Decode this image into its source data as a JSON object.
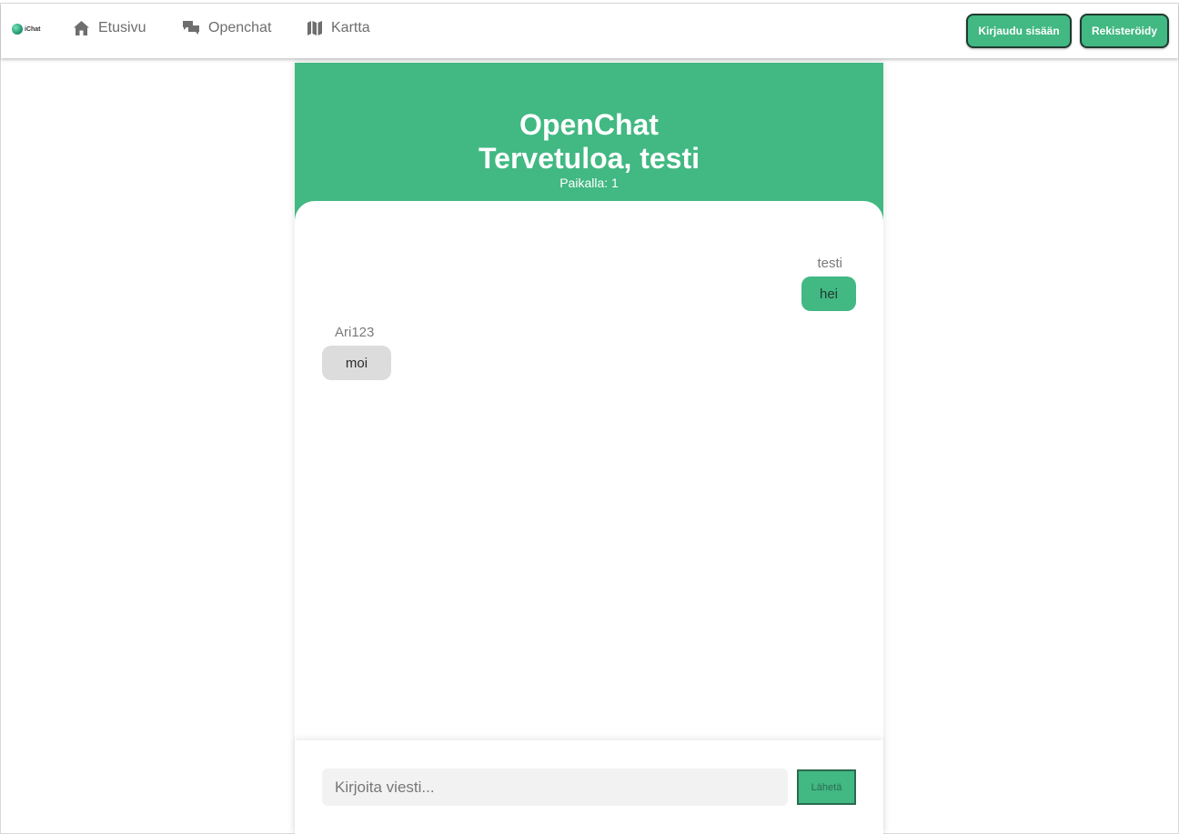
{
  "nav": {
    "logo_text": "iChat",
    "items": [
      {
        "label": "Etusivu",
        "icon": "home-icon"
      },
      {
        "label": "Openchat",
        "icon": "chat-bubbles-icon"
      },
      {
        "label": "Kartta",
        "icon": "map-icon"
      }
    ],
    "login_label": "Kirjaudu sisään",
    "register_label": "Rekisteröidy"
  },
  "chat": {
    "title": "OpenChat",
    "welcome": "Tervetuloa, testi",
    "online": "Paikalla: 1",
    "messages": [
      {
        "user": "testi",
        "text": "hei",
        "own": true
      },
      {
        "user": "Ari123",
        "text": "moi",
        "own": false
      }
    ],
    "input_placeholder": "Kirjoita viesti...",
    "send_label": "Lähetä"
  },
  "colors": {
    "accent": "#42b883",
    "bubble_other": "#dcdcdc",
    "nav_text": "#6e6e6e"
  }
}
